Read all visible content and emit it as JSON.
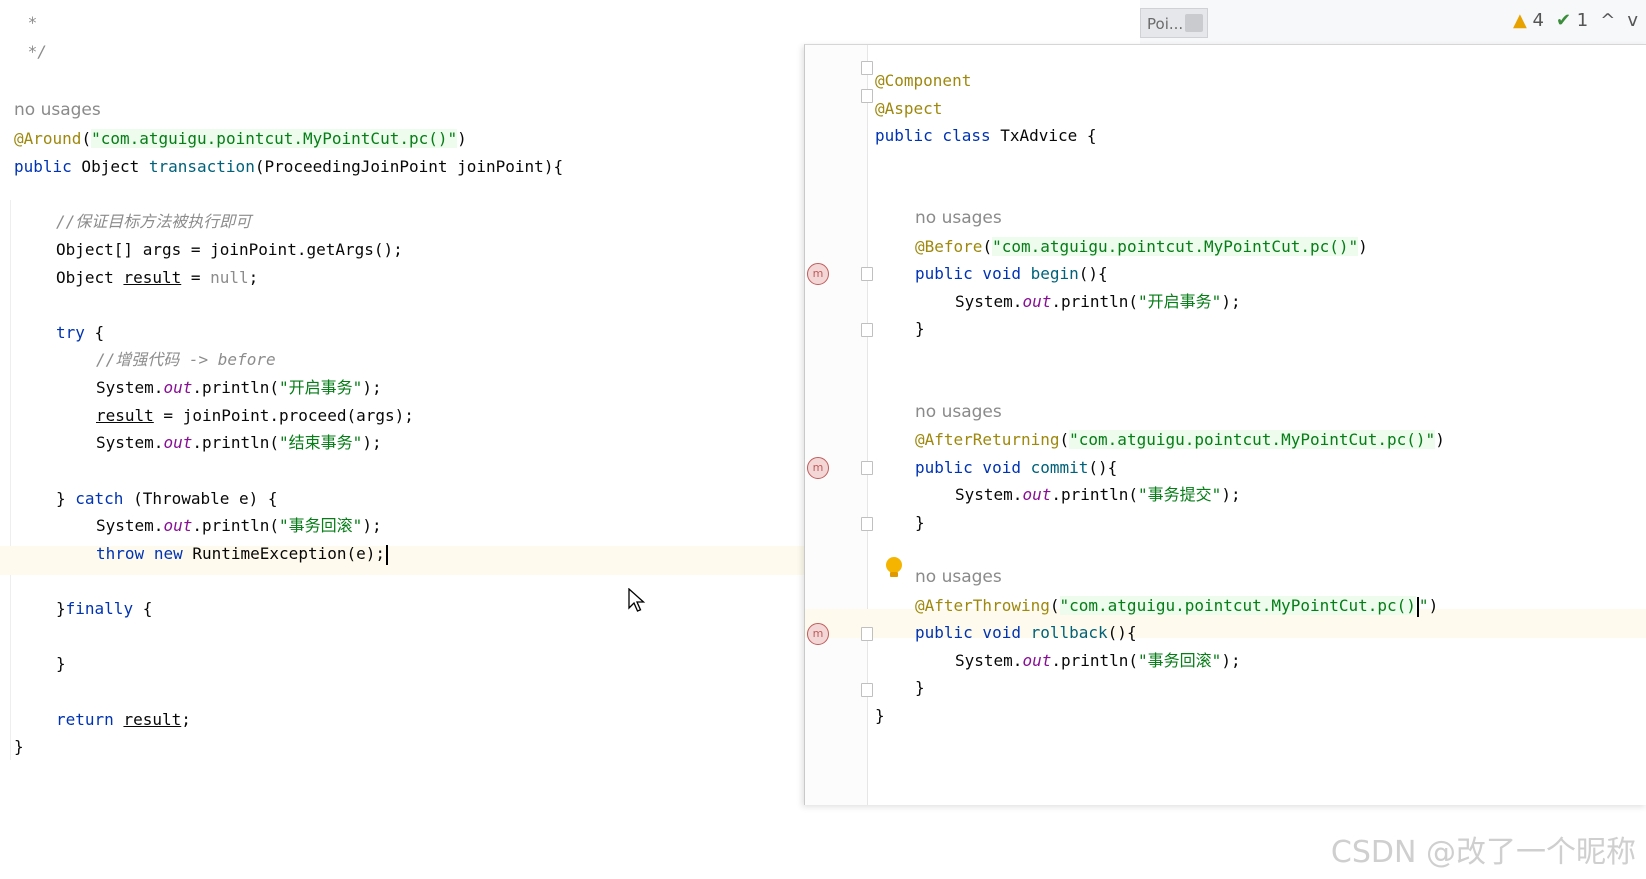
{
  "left_editor": {
    "comment_star": " *",
    "comment_end": " */",
    "hint_no_usages": "no usages",
    "around_ann": "@Around",
    "around_value": "\"com.atguigu.pointcut.MyPointCut.pc()\"",
    "method_sig_public": "public",
    "method_sig_rest": " Object ",
    "method_name": "transaction",
    "method_params": "(ProceedingJoinPoint joinPoint){",
    "comment_1": "//保证目标方法被执行即可",
    "line_args": "Object[] args = joinPoint.getArgs();",
    "line_result_a": "Object ",
    "line_result_var": "result",
    "line_result_b": " = ",
    "line_result_null": "null",
    "line_result_end": ";",
    "try_kw": "try",
    "try_brace": " {",
    "comment_2": "//增强代码 -> before",
    "sysout_prefix": "System.",
    "sysout_out": "out",
    "sysout_mid": ".println(",
    "str_open": "\"开启事务\"",
    "str_close": "\"结束事务\"",
    "str_rollback": "\"事务回滚\"",
    "proceed_var": "result",
    "proceed_rest": " = joinPoint.proceed(args);",
    "catch_a": "} ",
    "catch_kw": "catch",
    "catch_rest": " (Throwable e) {",
    "throw_kw": "throw",
    "new_kw": "new",
    "throw_rest": " RuntimeException(e);",
    "finally_a": "}",
    "finally_kw": "finally",
    "finally_b": " {",
    "close_brace": "}",
    "return_kw": "return",
    "return_var": "result",
    "return_end": ";"
  },
  "right_panel": {
    "ann_component": "@Component",
    "ann_aspect": "@Aspect",
    "class_decl_kw": "public class",
    "class_name": " TxAdvice {",
    "hint_no_usages": "no usages",
    "ann_before": "@Before",
    "ann_after_returning": "@AfterReturning",
    "ann_after_throwing": "@AfterThrowing",
    "pointcut_str": "\"com.atguigu.pointcut.MyPointCut.pc()\"",
    "pointcut_str_cut": "\"com.atguigu.pointcut.MyPointCut.pc()",
    "pointcut_str_tail": "\"",
    "public_void": "public void",
    "m_begin": "begin",
    "m_commit": "commit",
    "m_rollback": "rollback",
    "paren_brace": "(){",
    "str_open": "\"开启事务\"",
    "str_commit": "\"事务提交\"",
    "str_rollback": "\"事务回滚\"",
    "gutter_icon": "m"
  },
  "toolbar": {
    "tab_label": "Poi...",
    "warnings_count": "4",
    "checks_count": "1",
    "up_arrow": "^",
    "down_arrow": "v"
  },
  "watermark": "CSDN @改了一个昵称"
}
